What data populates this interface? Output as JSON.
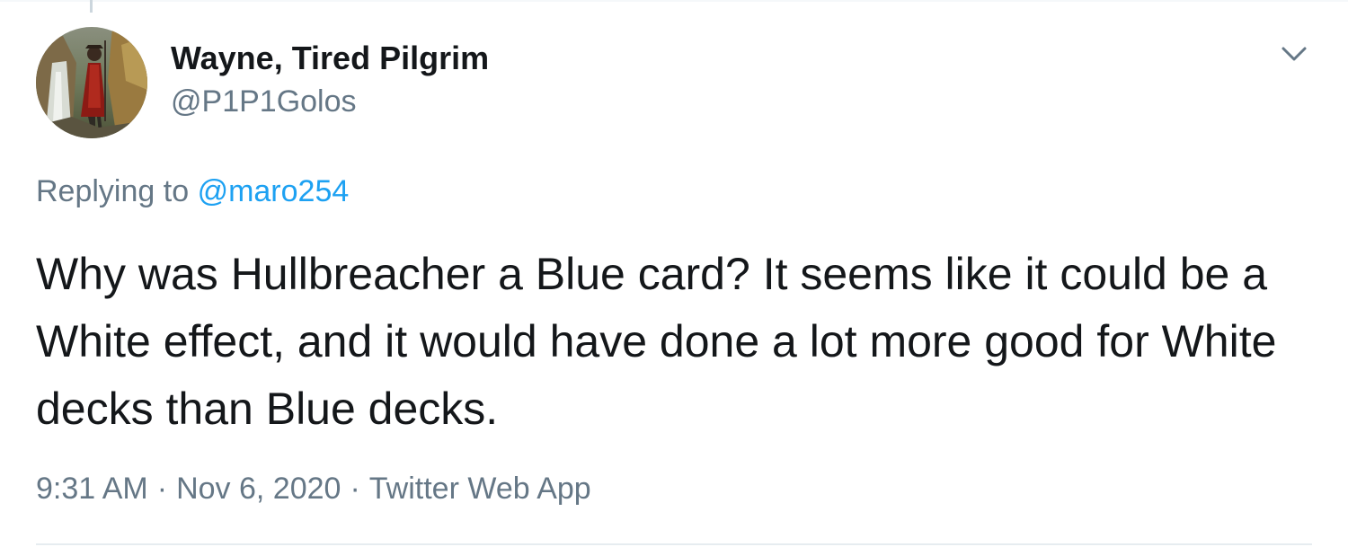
{
  "author": {
    "display_name": "Wayne, Tired Pilgrim",
    "handle": "@P1P1Golos"
  },
  "icons": {
    "avatar": "user-avatar",
    "menu": "chevron-down-icon"
  },
  "reply": {
    "prefix": "Replying to",
    "mention": "@maro254"
  },
  "tweet": {
    "text": "Why was Hullbreacher a Blue card? It seems like it could be a White effect, and it would have done a lot more good for White decks than Blue decks."
  },
  "meta": {
    "time": "9:31 AM",
    "separator": "·",
    "date": "Nov 6, 2020",
    "source": "Twitter Web App"
  },
  "colors": {
    "text": "#14171a",
    "secondary": "#657786",
    "accent": "#1da1f2"
  }
}
